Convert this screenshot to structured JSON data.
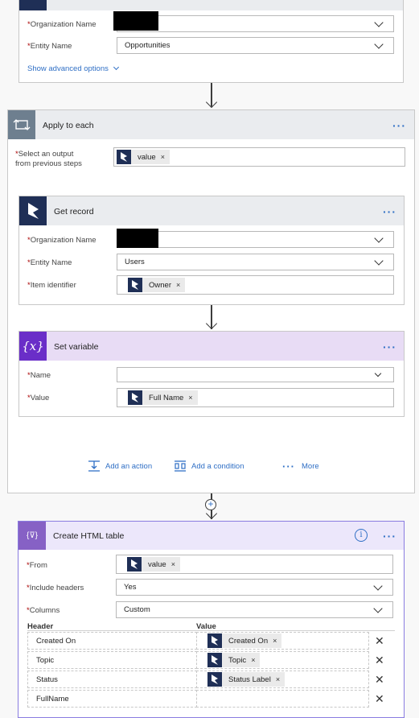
{
  "top_card": {
    "org_label": "Organization Name",
    "entity_label": "Entity Name",
    "entity_value": "Opportunities",
    "advanced_link": "Show advanced options"
  },
  "apply_each": {
    "title": "Apply to each",
    "select_label_line1": "Select an output",
    "select_label_line2": "from previous steps",
    "select_token": "value",
    "more_dots": "···"
  },
  "get_record": {
    "title": "Get record",
    "org_label": "Organization Name",
    "entity_label": "Entity Name",
    "entity_value": "Users",
    "item_label": "Item identifier",
    "item_token": "Owner",
    "more_dots": "···"
  },
  "set_variable": {
    "title": "Set variable",
    "icon_text": "{x}",
    "name_label": "Name",
    "value_label": "Value",
    "value_token": "Full Name",
    "more_dots": "···"
  },
  "actions": {
    "add_action": "Add an action",
    "add_condition": "Add a condition",
    "more_dots": "···",
    "more": "More"
  },
  "html_table": {
    "title": "Create HTML table",
    "icon_text": "{⊽}",
    "from_label": "From",
    "from_token": "value",
    "headers_label": "Include headers",
    "headers_value": "Yes",
    "columns_label": "Columns",
    "columns_value": "Custom",
    "col_header": "Header",
    "col_value": "Value",
    "info_icon": "i",
    "more_dots": "···",
    "rows": [
      {
        "header": "Created On",
        "token": "Created On"
      },
      {
        "header": "Topic",
        "token": "Topic"
      },
      {
        "header": "Status",
        "token": "Status Label"
      },
      {
        "header": "FullName",
        "token": ""
      }
    ]
  },
  "required_mark": "*",
  "token_close": "×",
  "delete_glyph": "✕",
  "colors": {
    "accent": "#2f6fc5",
    "dynamics_dark": "#1f2f56",
    "variable_purple": "#6a2ec8",
    "variable_header": "#e8dcf5",
    "grey_header": "#eaecef"
  }
}
